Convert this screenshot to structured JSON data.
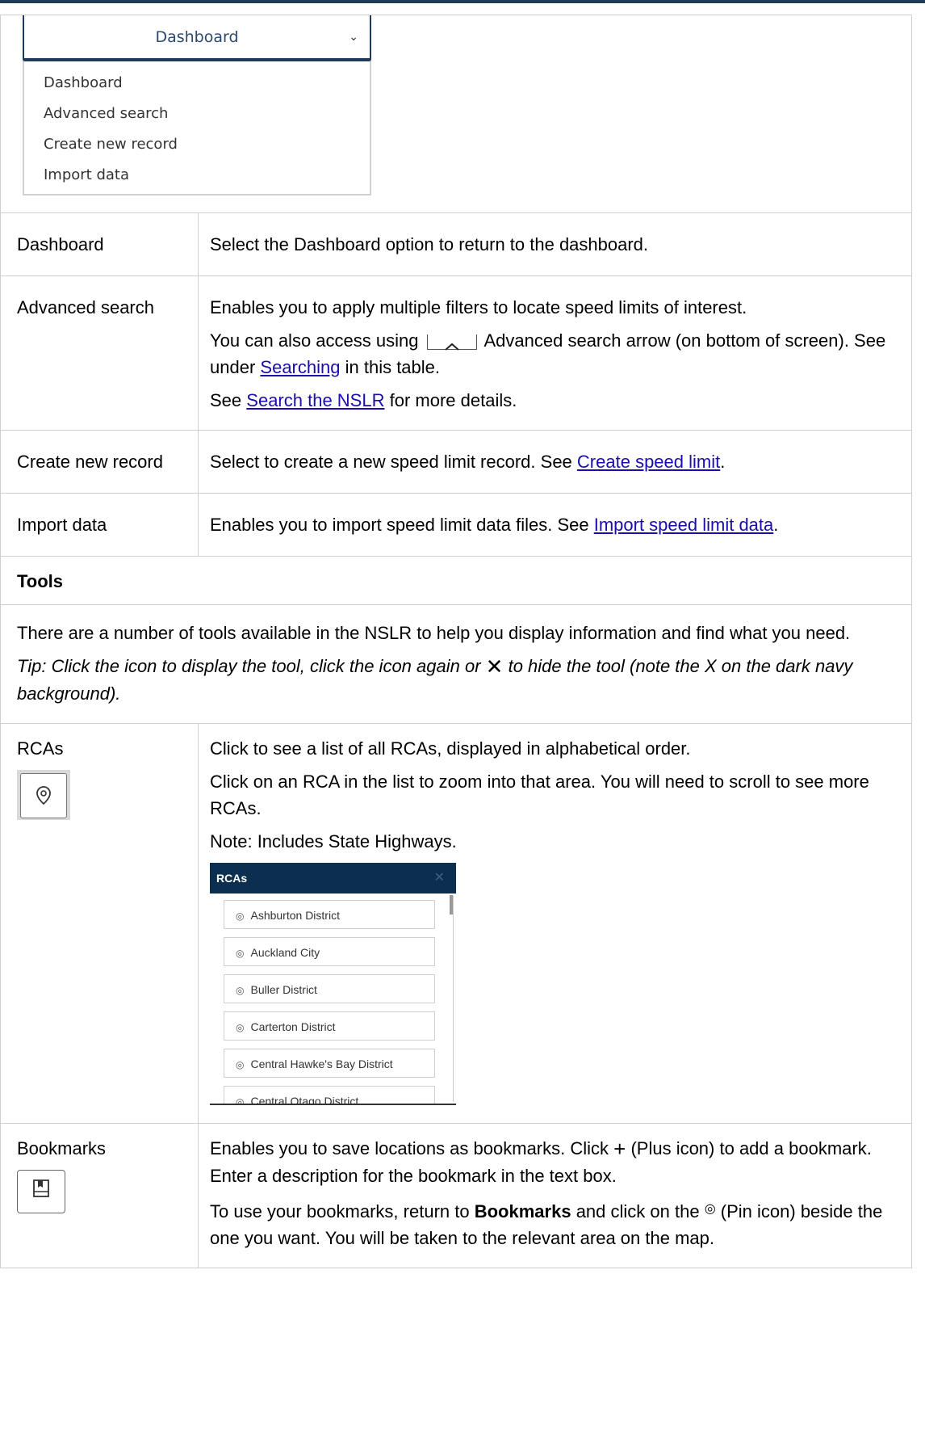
{
  "dropdown": {
    "selected": "Dashboard",
    "options": [
      "Dashboard",
      "Advanced search",
      "Create new record",
      "Import data"
    ]
  },
  "rows": {
    "dashboard": {
      "term": "Dashboard",
      "desc": "Select the Dashboard option to return to the dashboard."
    },
    "advanced": {
      "term": "Advanced search",
      "desc1": "Enables you to apply multiple filters to locate speed limits of interest.",
      "desc2_a": "You can also access using",
      "desc2_b": "Advanced search arrow (on bottom of screen). See under",
      "desc2_link": "Searching",
      "desc2_c": "in this table.",
      "desc3_a": "See",
      "desc3_link": "Search the NSLR",
      "desc3_b": "for more details."
    },
    "create": {
      "term": "Create new record",
      "desc_a": "Select to create a new speed limit record. See",
      "desc_link": "Create speed limit",
      "desc_b": "."
    },
    "import": {
      "term": "Import data",
      "desc_a": "Enables you to import speed limit data files. See",
      "desc_link": "Import speed limit data",
      "desc_b": "."
    },
    "tools": {
      "heading": "Tools",
      "intro": "There are a number of tools available in the NSLR to help you display information and find what you need.",
      "tip_a": "Tip: Click the icon to display the tool, click the icon again or",
      "tip_b": "to hide the tool (note the X on the dark navy background)."
    },
    "rcas": {
      "term": "RCAs",
      "desc1": "Click to see a list of all RCAs, displayed in alphabetical order.",
      "desc2": "Click on an RCA in the list to zoom into that area. You will need to scroll to see more RCAs.",
      "desc3": "Note: Includes State Highways.",
      "panel_title": "RCAs",
      "panel_close": "✕",
      "panel_items": [
        "Ashburton District",
        "Auckland City",
        "Buller District",
        "Carterton District",
        "Central Hawke's Bay District",
        "Central Otago District"
      ]
    },
    "bookmarks": {
      "term": "Bookmarks",
      "desc1_a": "Enables you to save locations as bookmarks. Click",
      "desc1_b": "(Plus icon) to add a bookmark. Enter a description for the bookmark in the text box.",
      "desc2_a": "To use your bookmarks, return to",
      "desc2_bold": "Bookmarks",
      "desc2_b": "and click on the",
      "desc2_c": "(Pin icon) beside the one you want. You will be taken to the relevant area on the map."
    }
  },
  "colors": {
    "navy": "#0d2f4f",
    "link": "#1a0dab",
    "border": "#cfcfcf"
  },
  "icons": [
    "chevron-down-icon",
    "chevron-up-icon",
    "close-icon",
    "pin-icon",
    "bookmark-icon",
    "plus-icon"
  ]
}
